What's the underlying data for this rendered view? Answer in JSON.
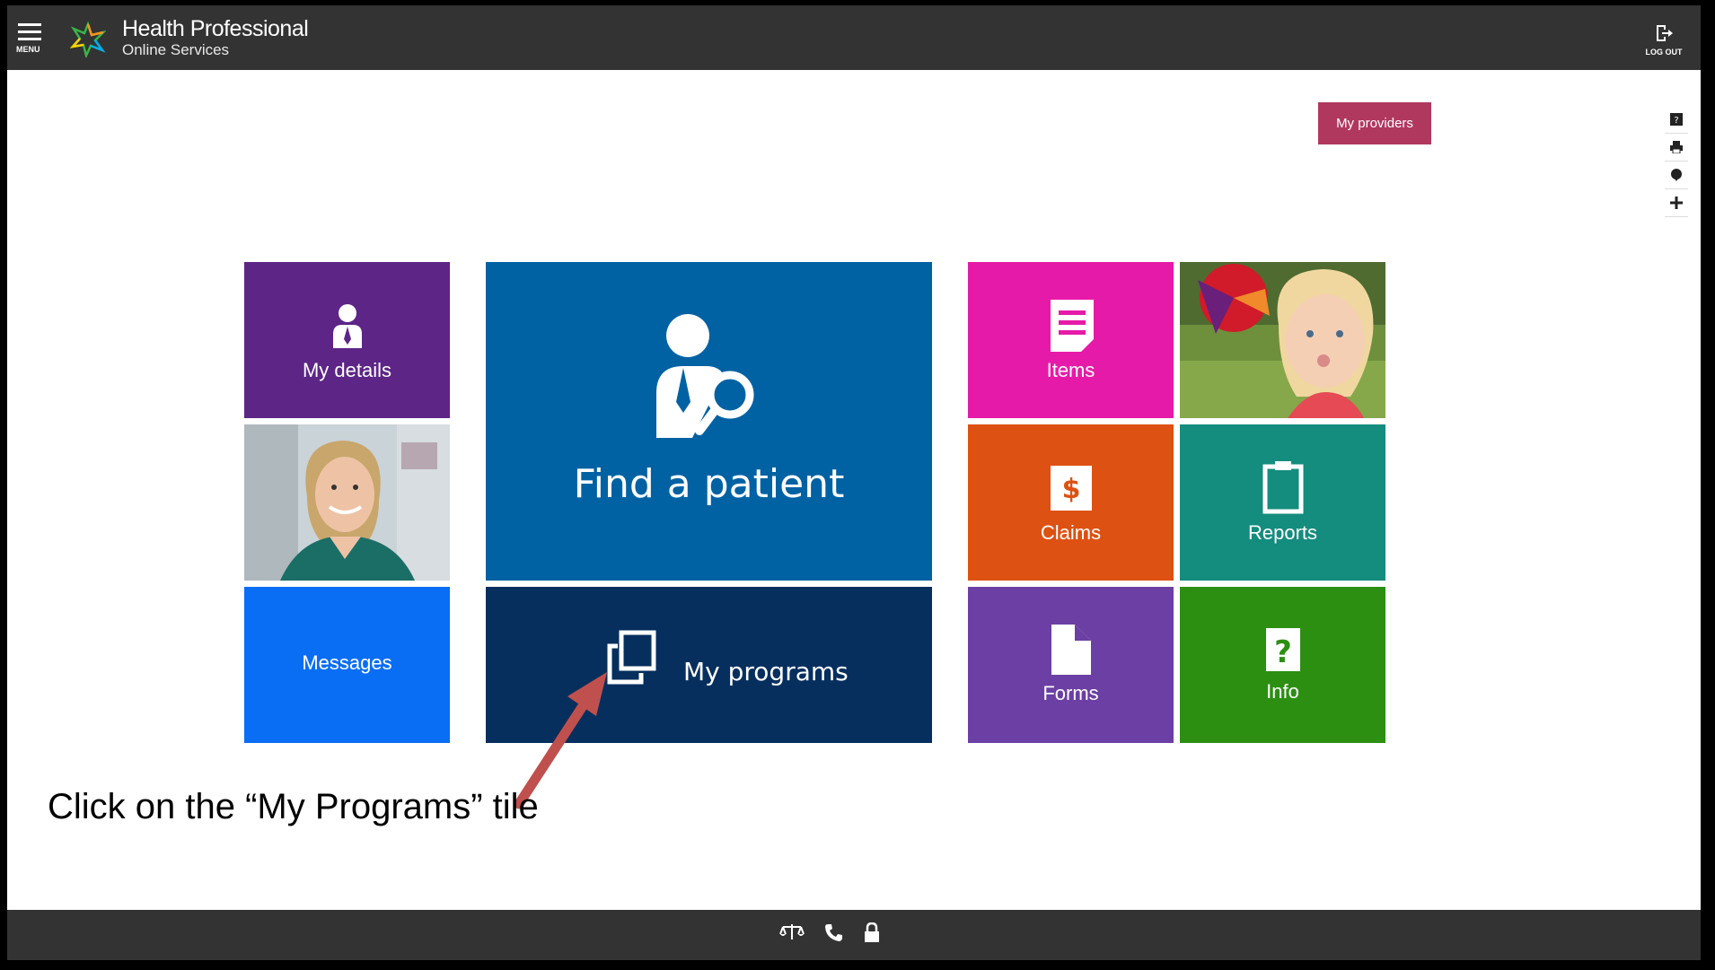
{
  "header": {
    "menu_label": "MENU",
    "title_line1": "Health Professional",
    "title_line2": "Online Services",
    "logout_label": "LOG OUT",
    "bg_color": "#333333"
  },
  "providers_button": {
    "label": "My providers",
    "color": "#b0385f"
  },
  "side_tools": [
    "help-icon",
    "print-icon",
    "feedback-icon",
    "add-icon"
  ],
  "tiles": {
    "my_details": {
      "label": "My details",
      "color": "#5c2586",
      "icon": "person-icon"
    },
    "messages": {
      "label": "Messages",
      "color": "#0a6ef5"
    },
    "find_patient": {
      "label": "Find a patient",
      "color": "#0062a3",
      "icon": "person-search-icon"
    },
    "my_programs": {
      "label": "My programs",
      "color": "#062f5e",
      "icon": "copy-icon"
    },
    "items": {
      "label": "Items",
      "color": "#e61aa8",
      "icon": "document-list-icon"
    },
    "claims": {
      "label": "Claims",
      "color": "#dd5112",
      "icon": "dollar-icon"
    },
    "reports": {
      "label": "Reports",
      "color": "#148c7e",
      "icon": "clipboard-icon"
    },
    "forms": {
      "label": "Forms",
      "color": "#6b3fa3",
      "icon": "file-icon"
    },
    "info": {
      "label": "Info",
      "color": "#2c8f12",
      "icon": "question-icon"
    }
  },
  "annotation": {
    "caption": "Click on the “My Programs” tile",
    "arrow_color": "#c0504d"
  },
  "footer": {
    "icons": [
      "scales-icon",
      "phone-icon",
      "lock-icon"
    ]
  }
}
